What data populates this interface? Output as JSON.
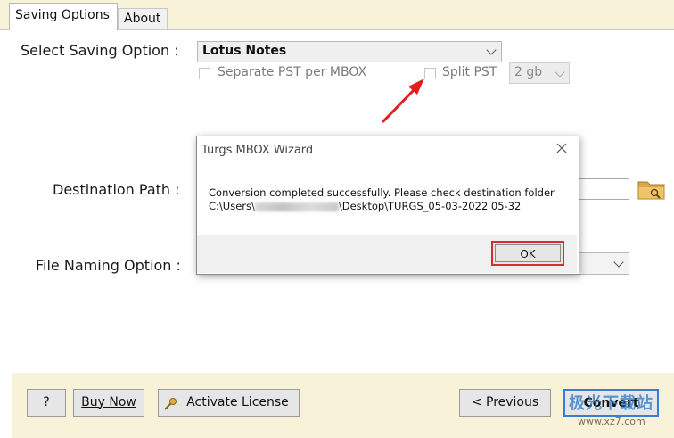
{
  "tabs": [
    {
      "label": "Saving Options"
    },
    {
      "label": "About"
    }
  ],
  "saving": {
    "label": "Select Saving Option :",
    "selected": "Lotus Notes",
    "separate_pst_label": "Separate PST per MBOX",
    "split_pst_label": "Split PST",
    "split_size": "2 gb"
  },
  "destination": {
    "label": "Destination Path :"
  },
  "naming": {
    "label": "File Naming Option :"
  },
  "dialog": {
    "title": "Turgs MBOX Wizard",
    "message": "Conversion completed successfully. Please check destination folder",
    "path_prefix": "C:\\Users\\",
    "path_suffix": "\\Desktop\\TURGS_05-03-2022 05-32",
    "ok_label": "OK"
  },
  "footer": {
    "help_label": "?",
    "buy_label": "Buy Now",
    "activate_label": "Activate License",
    "previous_label": "< Previous",
    "convert_label": "Convert"
  },
  "watermark": {
    "line1": "极光下载站",
    "line2": "www.xz7.com"
  },
  "colors": {
    "header_bg": "#f7f2d8",
    "ok_highlight": "#d32f2f",
    "convert_highlight": "#3a7bd5",
    "arrow": "#e02020"
  }
}
